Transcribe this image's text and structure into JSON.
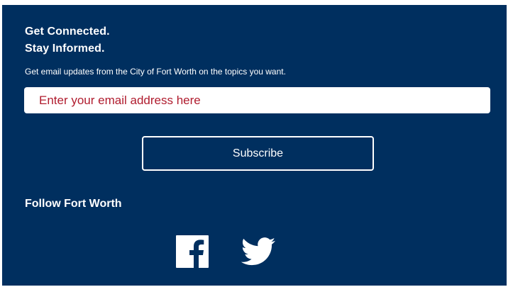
{
  "signup": {
    "heading_line1": "Get Connected.",
    "heading_line2": "Stay Informed.",
    "description": "Get email updates from the City of Fort Worth on the topics you want.",
    "email_placeholder": "Enter your email address here",
    "subscribe_label": "Subscribe"
  },
  "social": {
    "heading": "Follow Fort Worth",
    "links": [
      {
        "icon": "facebook-icon"
      },
      {
        "icon": "twitter-icon"
      }
    ]
  },
  "colors": {
    "panel_background": "#002f5f",
    "text": "#ffffff",
    "placeholder": "#b01c2e"
  }
}
